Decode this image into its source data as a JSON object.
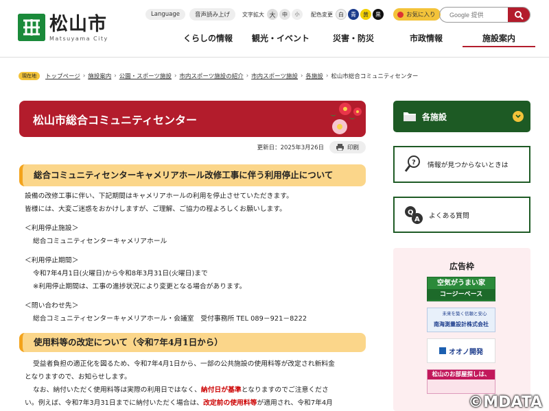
{
  "header": {
    "logo_name": "松山市",
    "logo_sub": "Matsuyama City",
    "language_label": "Language",
    "read_aloud_label": "音声読み上げ",
    "text_size_label": "文字拡大",
    "size_large": "大",
    "size_medium": "中",
    "size_small": "小",
    "color_label": "配色変更",
    "color_white": "白",
    "color_blue": "青",
    "color_yellow": "黄",
    "color_black": "黒",
    "favorite_label": "お気に入り",
    "search_placeholder": "Google 提供"
  },
  "gnav": [
    {
      "label": "くらしの情報"
    },
    {
      "label": "観光・イベント"
    },
    {
      "label": "災害・防災"
    },
    {
      "label": "市政情報"
    },
    {
      "label": "施設案内"
    }
  ],
  "breadcrumb": {
    "here_label": "現在地",
    "items": [
      "トップページ",
      "施設案内",
      "公園・スポーツ施設",
      "市内スポーツ施設の紹介",
      "市内スポーツ施設",
      "各施設"
    ],
    "current": "松山市総合コミュニティセンター"
  },
  "page": {
    "title": "松山市総合コミュニティセンター",
    "updated": "更新日：2025年3月26日",
    "print_label": "印刷"
  },
  "section1": {
    "heading": "総合コミュニティセンターキャメリアホール改修工事に伴う利用停止について",
    "intro_line1": "設備の改修工事に伴い、下記期間はキャメリアホールの利用を停止させていただきます。",
    "intro_line2": "皆様には、大変ご迷惑をおかけしますが、ご理解、ご協力の程よろしくお願いします。",
    "facility_label": "＜利用停止施設＞",
    "facility_value": "総合コミュニティセンターキャメリアホール",
    "period_label": "＜利用停止期間＞",
    "period_value": "令和7年4月1日(火曜日)から令和8年3月31日(火曜日)まで",
    "period_note": "※利用停止期間は、工事の進捗状況により変更となる場合があります。",
    "contact_label": "＜問い合わせ先＞",
    "contact_value": "総合コミュニティセンターキャメリアホール・会議室　受付事務所 TEL 089－921－8222"
  },
  "section2": {
    "heading": "使用料等の改定について（令和7年4月1日から）",
    "line1": "受益者負担の適正化を図るため、令和7年4月1日から、一部の公共施設の使用料等が改定され新料金",
    "line2": "となりますので、お知らせします。",
    "line3_a": "なお、納付いただく使用料等は実際の利用日ではなく、",
    "line3_red": "納付日が基準",
    "line3_b": "となりますのでご注意くださ",
    "line4_a": "い。例えば、令和7年3月31日までに納付いただく場合は、",
    "line4_red": "改定前の使用料等",
    "line4_b": "が適用され、令和7年4月"
  },
  "side": {
    "nav_label": "各施設",
    "card1_label": "情報が見つからないときは",
    "card2_label": "よくある質問",
    "ad_title": "広告枠",
    "ad1_line1": "空気がうまい家",
    "ad1_line2": "コージーベース",
    "ad2_line1": "未来を築く信頼と安心",
    "ad2_line2": "南海測量設計株式会社",
    "ad3_label": "オオノ開発",
    "ad4_line1": "松山のお部屋探しは、"
  },
  "watermark": "©MDATA",
  "colors": {
    "brand_red": "#b31c2c",
    "brand_green": "#1d5a24",
    "accent_yellow": "#f3c33a",
    "heading_bg": "#fbd68a"
  }
}
